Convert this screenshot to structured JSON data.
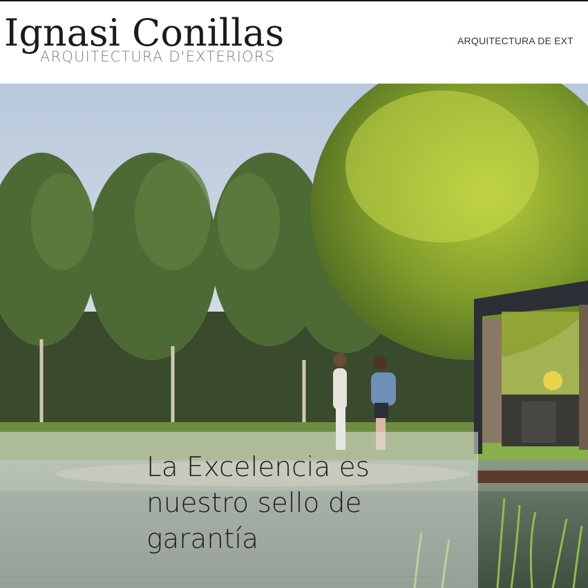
{
  "brand": {
    "name": "Ignasi Conillas",
    "tagline": "ARQUITECTURA D'EXTERIORS"
  },
  "nav": {
    "item_1": "ARQUITECTURA DE EXT"
  },
  "hero": {
    "caption": "La Excelencia es nuestro sello de garantía"
  },
  "colors": {
    "nav_text": "#2c3a2e",
    "caption_text": "#1d1d1d",
    "caption_panel": "#e0e4de"
  }
}
